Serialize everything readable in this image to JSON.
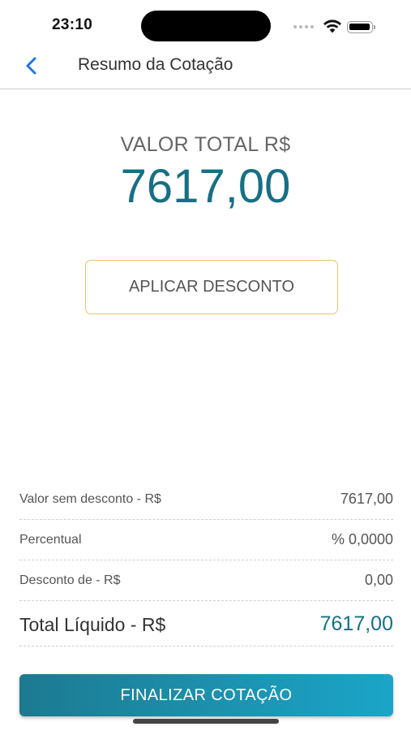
{
  "status_bar": {
    "time": "23:10",
    "icons": [
      "cellular-dots-icon",
      "wifi-icon",
      "battery-icon"
    ]
  },
  "header": {
    "back_icon": "chevron-left-icon",
    "title": "Resumo da Cotação"
  },
  "total": {
    "label": "VALOR TOTAL R$",
    "value": "7617,00"
  },
  "actions": {
    "discount_label": "APLICAR DESCONTO",
    "finalize_label": "FINALIZAR COTAÇÃO"
  },
  "summary": {
    "rows": [
      {
        "label": "Valor sem desconto - R$",
        "value": "7617,00"
      },
      {
        "label": "Percentual",
        "value": "% 0,0000"
      },
      {
        "label": "Desconto de - R$",
        "value": "0,00"
      }
    ],
    "total_label": "Total Líquido - R$",
    "total_value": "7617,00"
  },
  "colors": {
    "accent": "#176f85",
    "back_icon": "#1a7ae0",
    "discount_border": "#e8c46a",
    "button_gradient_start": "#1c7a90",
    "button_gradient_end": "#1ba5c9"
  }
}
